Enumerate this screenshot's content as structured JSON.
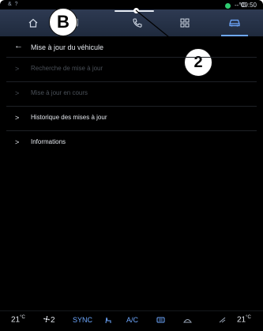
{
  "status": {
    "left_icons": "& ?",
    "temperature": "--°C",
    "time": "09:50"
  },
  "nav": {
    "items": [
      {
        "id": "home",
        "icon": "home-icon"
      },
      {
        "id": "music",
        "icon": "music-icon"
      },
      {
        "id": "phone",
        "icon": "phone-icon"
      },
      {
        "id": "apps",
        "icon": "apps-grid-icon"
      },
      {
        "id": "vehicle",
        "icon": "car-icon",
        "active": true
      }
    ]
  },
  "callouts": {
    "b": "B",
    "two": "2"
  },
  "page": {
    "back_label": "←",
    "title": "Mise à jour du véhicule"
  },
  "menu": [
    {
      "label": "Recherche de mise à jour",
      "enabled": false
    },
    {
      "label": "Mise à jour en cours",
      "enabled": false
    },
    {
      "label": "Historique des mises à jour",
      "enabled": true
    },
    {
      "label": "Informations",
      "enabled": true
    }
  ],
  "menu_chevron": ">",
  "bottom_bar": {
    "temp_left": "21",
    "temp_left_unit": "°C",
    "fan_speed": "2",
    "sync_label": "SYNC",
    "ac_label": "A/C",
    "temp_right": "21",
    "temp_right_unit": "°C"
  },
  "colors": {
    "accent": "#6ea8ff",
    "background": "#000000",
    "navbar": "#2e3a52",
    "disabled_text": "#4a5058",
    "enabled_text": "#e4e8ee"
  }
}
